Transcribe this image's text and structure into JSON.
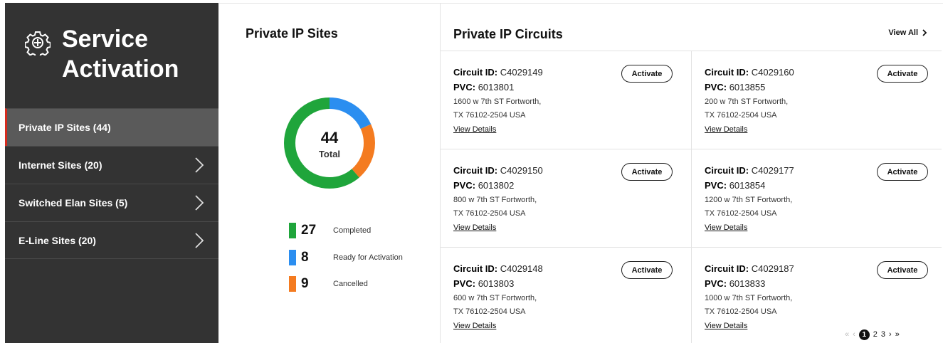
{
  "sidebar": {
    "title_line1": "Service",
    "title_line2": "Activation",
    "icon": "gear-icon",
    "items": [
      {
        "label": "Private IP Sites (44)",
        "active": true
      },
      {
        "label": "Internet Sites (20)",
        "active": false
      },
      {
        "label": "Switched Elan Sites (5)",
        "active": false
      },
      {
        "label": "E-Line Sites (20)",
        "active": false
      }
    ]
  },
  "sites": {
    "title": "Private IP Sites",
    "total_value": "44",
    "total_label": "Total",
    "legend": [
      {
        "count": "27",
        "label": "Completed",
        "color": "#1fa53b"
      },
      {
        "count": "8",
        "label": "Ready for Activation",
        "color": "#2b8ef0"
      },
      {
        "count": "9",
        "label": "Cancelled",
        "color": "#f47b20"
      }
    ]
  },
  "circuits": {
    "title": "Private IP Circuits",
    "view_all": "View All",
    "circuit_id_label": "Circuit ID:",
    "pvc_label": "PVC:",
    "activate_label": "Activate",
    "view_details_label": "View Details",
    "cards": [
      {
        "circuit_id": "C4029149",
        "pvc": "6013801",
        "addr1": "1600 w 7th ST Fortworth,",
        "addr2": "TX 76102-2504 USA"
      },
      {
        "circuit_id": "C4029160",
        "pvc": "6013855",
        "addr1": "200 w 7th ST Fortworth,",
        "addr2": "TX 76102-2504 USA"
      },
      {
        "circuit_id": "C4029150",
        "pvc": "6013802",
        "addr1": "800 w 7th ST Fortworth,",
        "addr2": "TX 76102-2504 USA"
      },
      {
        "circuit_id": "C4029177",
        "pvc": "6013854",
        "addr1": "1200 w 7th ST Fortworth,",
        "addr2": "TX 76102-2504 USA"
      },
      {
        "circuit_id": "C4029148",
        "pvc": "6013803",
        "addr1": "600 w 7th ST Fortworth,",
        "addr2": "TX 76102-2504 USA"
      },
      {
        "circuit_id": "C4029187",
        "pvc": "6013833",
        "addr1": "1000 w 7th ST Fortworth,",
        "addr2": "TX 76102-2504 USA"
      }
    ]
  },
  "pagination": {
    "first": "«",
    "prev": "‹",
    "pages": [
      "1",
      "2",
      "3"
    ],
    "current": "1",
    "next": "›",
    "last": "»"
  }
}
